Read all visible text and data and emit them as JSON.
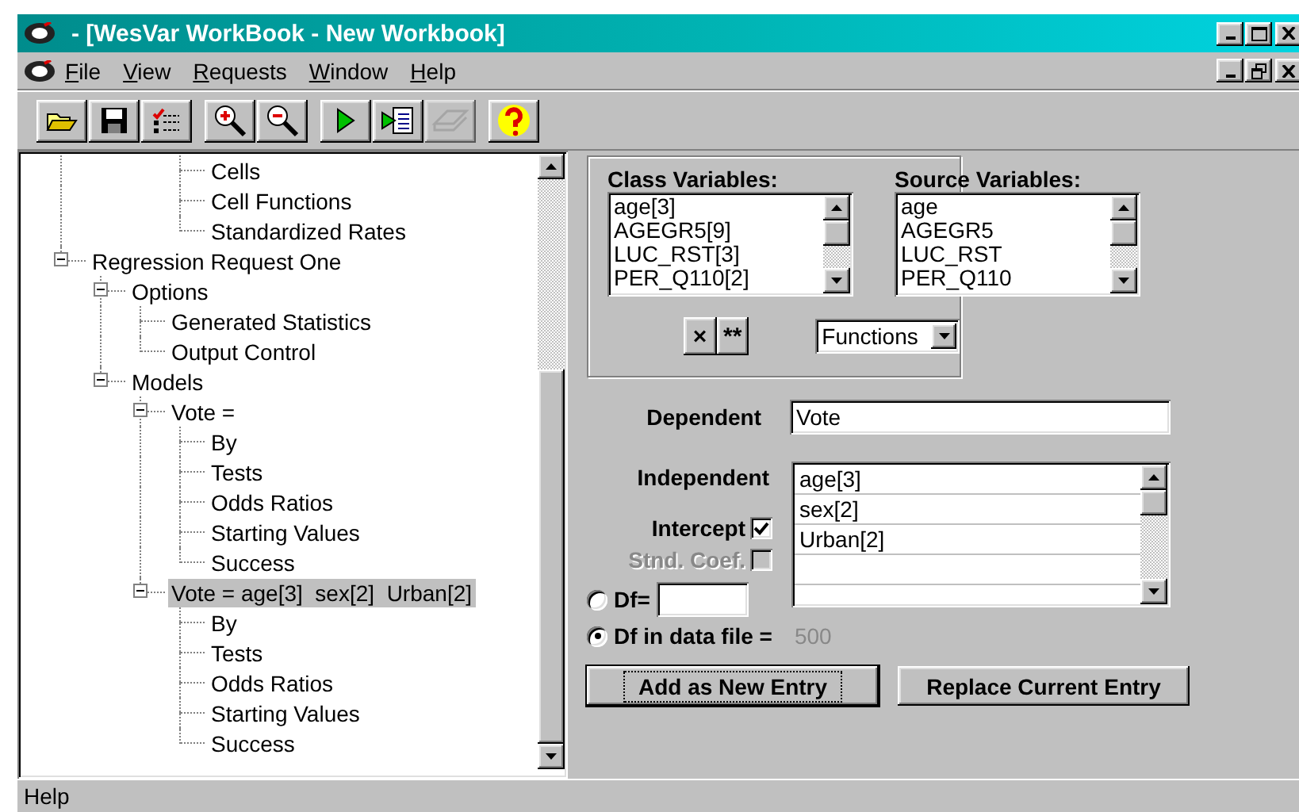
{
  "window": {
    "title": "- [WesVar WorkBook - New Workbook]"
  },
  "menu": [
    "File",
    "View",
    "Requests",
    "Window",
    "Help"
  ],
  "toolbar": {
    "groups": [
      [
        {
          "disabled": false
        },
        {
          "disabled": false
        },
        {
          "disabled": false
        }
      ],
      [
        {
          "disabled": false
        },
        {
          "disabled": false
        }
      ],
      [
        {
          "disabled": false
        },
        {
          "disabled": false
        },
        {
          "disabled": true
        }
      ],
      [
        {
          "disabled": false
        }
      ]
    ]
  },
  "tree": {
    "items": [
      {
        "children": [
          {
            "children": [
              {
                "children": [
                  {
                    "label": "Cells",
                    "selected": false
                  },
                  {
                    "label": "Cell Functions",
                    "selected": false
                  },
                  {
                    "label": "Standardized Rates",
                    "selected": false
                  }
                ]
              }
            ]
          }
        ]
      },
      {
        "label": "Regression Request One",
        "selected": false,
        "expanded": true,
        "children": [
          {
            "label": "Options",
            "selected": false,
            "expanded": true,
            "children": [
              {
                "label": "Generated Statistics",
                "selected": false
              },
              {
                "label": "Output Control",
                "selected": false
              }
            ]
          },
          {
            "label": "Models",
            "selected": false,
            "expanded": true,
            "children": [
              {
                "label": "Vote =",
                "selected": false,
                "expanded": true,
                "children": [
                  {
                    "label": "By",
                    "selected": false
                  },
                  {
                    "label": "Tests",
                    "selected": false
                  },
                  {
                    "label": "Odds Ratios",
                    "selected": false
                  },
                  {
                    "label": "Starting Values",
                    "selected": false
                  },
                  {
                    "label": "Success",
                    "selected": false
                  }
                ]
              },
              {
                "label": "Vote = age[3]  sex[2]  Urban[2]",
                "selected": true,
                "expanded": true,
                "children": [
                  {
                    "label": "By",
                    "selected": false
                  },
                  {
                    "label": "Tests",
                    "selected": false
                  },
                  {
                    "label": "Odds Ratios",
                    "selected": false
                  },
                  {
                    "label": "Starting Values",
                    "selected": false
                  },
                  {
                    "label": "Success",
                    "selected": false
                  }
                ]
              }
            ]
          }
        ]
      }
    ]
  },
  "class_variables": {
    "label": "Class Variables:",
    "items": [
      "age[3]",
      "AGEGR5[9]",
      "LUC_RST[3]",
      "PER_Q110[2]"
    ]
  },
  "source_variables": {
    "label": "Source Variables:",
    "items": [
      "age",
      "AGEGR5",
      "LUC_RST",
      "PER_Q110"
    ]
  },
  "operator_buttons": [
    "×",
    "**"
  ],
  "functions_dropdown": {
    "value": "Functions"
  },
  "dependent": {
    "label": "Dependent",
    "value": "Vote"
  },
  "independent": {
    "label": "Independent",
    "items": [
      "age[3]",
      "sex[2]",
      "Urban[2]"
    ]
  },
  "options": [
    {
      "label": "Intercept",
      "checked": true,
      "disabled": false
    },
    {
      "label": "Stnd. Coef.",
      "checked": false,
      "disabled": true
    }
  ],
  "df_options": [
    {
      "label": "Df=",
      "selected": false
    },
    {
      "label": "Df in data file =",
      "selected": true,
      "value": "500",
      "disabled": true
    }
  ],
  "buttons": [
    {
      "label": "Add as New Entry",
      "default": true
    },
    {
      "label": "Replace Current Entry",
      "default": false
    }
  ],
  "status_bar": "Help"
}
